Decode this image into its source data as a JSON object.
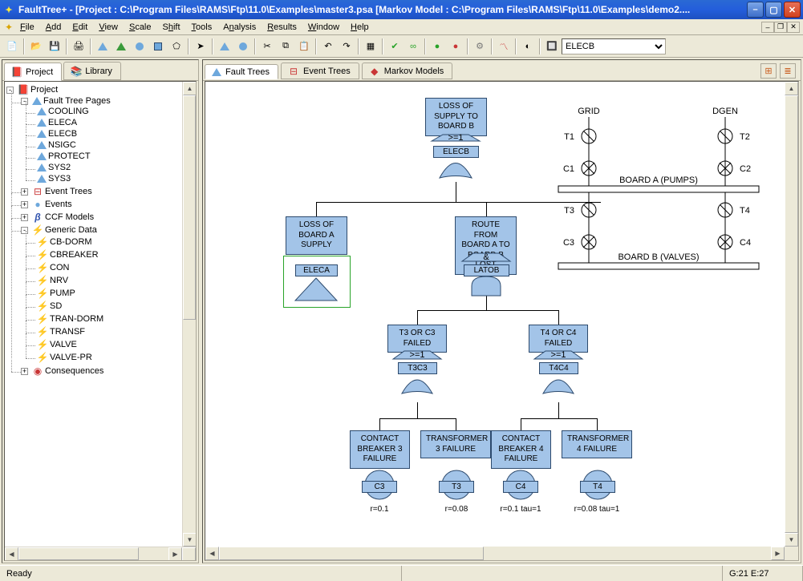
{
  "window": {
    "title": "FaultTree+ - [Project : C:\\Program Files\\RAMS\\Ftp\\11.0\\Examples\\master3.psa [Markov Model : C:\\Program Files\\RAMS\\Ftp\\11.0\\Examples\\demo2...."
  },
  "menu": {
    "file": "File",
    "add": "Add",
    "edit": "Edit",
    "view": "View",
    "scale": "Scale",
    "shift": "Shift",
    "tools": "Tools",
    "analysis": "Analysis",
    "results": "Results",
    "window": "Window",
    "help": "Help"
  },
  "toolbar": {
    "dropdown_value": "ELECB"
  },
  "sidebar": {
    "tabs": {
      "project": "Project",
      "library": "Library"
    },
    "root": "Project",
    "fault_tree_pages": "Fault Tree Pages",
    "ft_items": [
      "COOLING",
      "ELECA",
      "ELECB",
      "NSIGC",
      "PROTECT",
      "SYS2",
      "SYS3"
    ],
    "event_trees": "Event Trees",
    "events": "Events",
    "ccf_models": "CCF Models",
    "generic_data": "Generic Data",
    "gd_items": [
      "CB-DORM",
      "CBREAKER",
      "CON",
      "NRV",
      "PUMP",
      "SD",
      "TRAN-DORM",
      "TRANSF",
      "VALVE",
      "VALVE-PR"
    ],
    "consequences": "Consequences"
  },
  "content_tabs": {
    "fault_trees": "Fault Trees",
    "event_trees": "Event Trees",
    "markov": "Markov Models"
  },
  "diagram": {
    "top_desc": "LOSS OF SUPPLY TO BOARD B",
    "top_name": "ELECB",
    "top_vote": ">=1",
    "left_desc": "LOSS OF BOARD A SUPPLY",
    "left_name": "ELECA",
    "right_desc": "ROUTE FROM BOARD A TO BOARD B LOST",
    "right_name": "LATOB",
    "right_gate": "&",
    "t3c3_desc": "T3 OR C3 FAILED",
    "t3c3_name": "T3C3",
    "t3c3_vote": ">=1",
    "t4c4_desc": "T4 OR C4 FAILED",
    "t4c4_name": "T4C4",
    "t4c4_vote": ">=1",
    "c3_desc": "CONTACT BREAKER 3 FAILURE",
    "c3_name": "C3",
    "c3_rate": "r=0.1",
    "t3_desc": "TRANSFORMER 3 FAILURE",
    "t3_name": "T3",
    "t3_rate": "r=0.08",
    "c4_desc": "CONTACT BREAKER 4 FAILURE",
    "c4_name": "C4",
    "c4_rate": "r=0.1 tau=1",
    "t4_desc": "TRANSFORMER 4 FAILURE",
    "t4_name": "T4",
    "t4_rate": "r=0.08 tau=1"
  },
  "schematic": {
    "grid": "GRID",
    "dgen": "DGEN",
    "t1": "T1",
    "t2": "T2",
    "t3": "T3",
    "t4": "T4",
    "c1": "C1",
    "c2": "C2",
    "c3": "C3",
    "c4": "C4",
    "board_a": "BOARD A (PUMPS)",
    "board_b": "BOARD B (VALVES)"
  },
  "statusbar": {
    "ready": "Ready",
    "pos": "G:21 E:27"
  }
}
